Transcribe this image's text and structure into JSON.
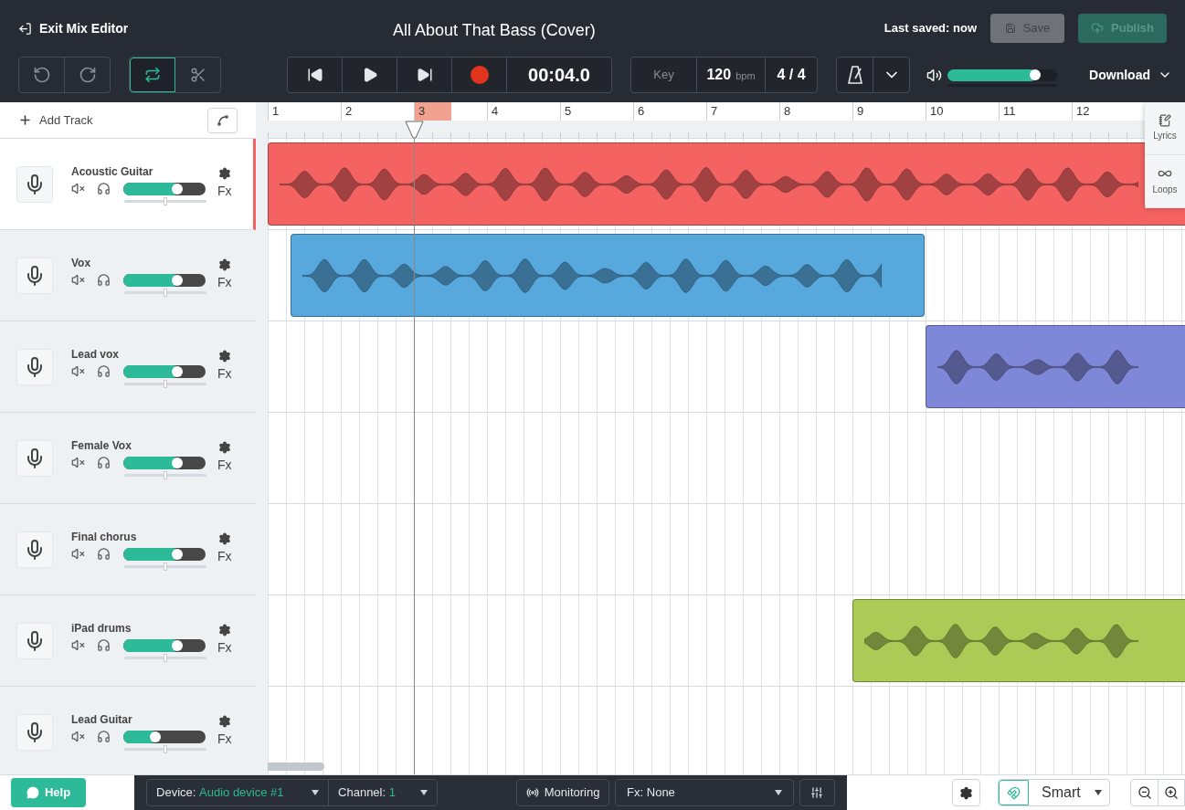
{
  "header": {
    "exit_label": "Exit Mix Editor",
    "title": "All About That Bass (Cover)",
    "last_saved": "Last saved: now",
    "save": {
      "label": "Save",
      "disabled": true
    },
    "publish": {
      "label": "Publish",
      "disabled": true
    }
  },
  "toolbar": {
    "loop_on": true,
    "cut_on": false,
    "time": "00:04.0",
    "key": "Key",
    "tempo": "120",
    "tempo_unit": "bpm",
    "signature": "4 / 4",
    "volume": {
      "level": 0.82
    },
    "download": "Download"
  },
  "sidebar": {
    "add_track": "Add Track"
  },
  "ruler": {
    "bars": [
      {
        "label": "1",
        "selected": false
      },
      {
        "label": "2",
        "selected": false
      },
      {
        "label": "3",
        "selected": true
      },
      {
        "label": "4",
        "selected": false
      },
      {
        "label": "5",
        "selected": false
      },
      {
        "label": "6",
        "selected": false
      },
      {
        "label": "7",
        "selected": false
      },
      {
        "label": "8",
        "selected": false
      },
      {
        "label": "9",
        "selected": false
      },
      {
        "label": "10",
        "selected": false
      },
      {
        "label": "11",
        "selected": false
      },
      {
        "label": "12",
        "selected": false
      }
    ]
  },
  "tracks": [
    {
      "name": "Acoustic Guitar",
      "selected": true,
      "volume": {
        "level": 0.68
      },
      "pan": {
        "level": 0.5
      },
      "fx": "Fx",
      "clip": {
        "color": "#f46262"
      }
    },
    {
      "name": "Vox",
      "selected": false,
      "volume": {
        "level": 0.68
      },
      "pan": {
        "level": 0.5
      },
      "fx": "Fx",
      "clip": {
        "color": "#56a8dd"
      }
    },
    {
      "name": "Lead vox",
      "selected": false,
      "volume": {
        "level": 0.68
      },
      "pan": {
        "level": 0.5
      },
      "fx": "Fx",
      "clip": {
        "color": "#7f88d8"
      }
    },
    {
      "name": "Female Vox",
      "selected": false,
      "volume": {
        "level": 0.68
      },
      "pan": {
        "level": 0.5
      },
      "fx": "Fx"
    },
    {
      "name": "Final chorus",
      "selected": false,
      "volume": {
        "level": 0.68
      },
      "pan": {
        "level": 0.5
      },
      "fx": "Fx"
    },
    {
      "name": "iPad drums",
      "selected": false,
      "volume": {
        "level": 0.68
      },
      "pan": {
        "level": 0.5
      },
      "fx": "Fx",
      "clip": {
        "color": "#abcb56"
      }
    },
    {
      "name": "Lead Guitar",
      "selected": false,
      "volume": {
        "level": 0.41
      },
      "pan": {
        "level": 0.5
      },
      "fx": "Fx"
    }
  ],
  "side_panel": [
    {
      "kind": "lyrics",
      "label": "Lyrics"
    },
    {
      "kind": "loops",
      "label": "Loops"
    }
  ],
  "footer": {
    "help": "Help",
    "device_label": "Device:",
    "device_value": "Audio device #1",
    "channel_label": "Channel:",
    "channel_value": "1",
    "monitoring": "Monitoring",
    "fx": "Fx: None",
    "snap_on": true,
    "snap_mode": "Smart"
  }
}
